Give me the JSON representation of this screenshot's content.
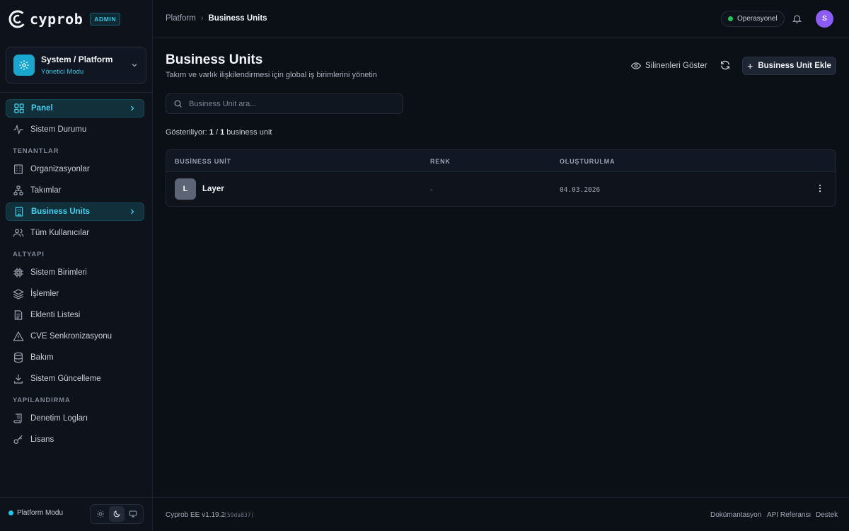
{
  "brand": {
    "name": "cyprob",
    "badge": "ADMIN"
  },
  "workspace": {
    "title": "System / Platform",
    "subtitle": "Yönetici Modu"
  },
  "nav": {
    "items_top": [
      {
        "label": "Panel",
        "icon": "dashboard-icon",
        "active": true
      },
      {
        "label": "Sistem Durumu",
        "icon": "activity-icon"
      }
    ],
    "sections": [
      {
        "label": "TENANTLAR",
        "items": [
          {
            "label": "Organizasyonlar",
            "icon": "building-icon"
          },
          {
            "label": "Takımlar",
            "icon": "network-icon"
          },
          {
            "label": "Business Units",
            "icon": "office-icon",
            "active": true
          },
          {
            "label": "Tüm Kullanıcılar",
            "icon": "users-icon"
          }
        ]
      },
      {
        "label": "ALTYAPI",
        "items": [
          {
            "label": "Sistem Birimleri",
            "icon": "cpu-icon"
          },
          {
            "label": "İşlemler",
            "icon": "layers-icon"
          },
          {
            "label": "Eklenti Listesi",
            "icon": "list-icon"
          },
          {
            "label": "CVE Senkronizasyonu",
            "icon": "warning-icon"
          },
          {
            "label": "Bakım",
            "icon": "database-icon"
          },
          {
            "label": "Sistem Güncelleme",
            "icon": "download-icon"
          }
        ]
      },
      {
        "label": "YAPILANDIRMA",
        "items": [
          {
            "label": "Denetim Logları",
            "icon": "scroll-icon"
          },
          {
            "label": "Lisans",
            "icon": "key-icon"
          }
        ]
      }
    ]
  },
  "sidebar_footer": {
    "mode_label": "Platform Modu",
    "theme": "dark"
  },
  "topbar": {
    "breadcrumb": [
      "Platform",
      "Business Units"
    ],
    "status": "Operasyonel",
    "avatar_initial": "S"
  },
  "page": {
    "title": "Business Units",
    "subtitle": "Takım ve varlık ilişkilendirmesi için global iş birimlerini yönetin",
    "show_deleted_label": "Silinenleri Göster",
    "add_label": "Business Unit Ekle",
    "search_placeholder": "Business Unit ara...",
    "count": {
      "prefix": "Gösteriliyor:",
      "shown": "1",
      "sep": "/",
      "total": "1",
      "suffix": "business unit"
    }
  },
  "table": {
    "headers": [
      "BUSİNESS UNİT",
      "RENK",
      "OLUŞTURULMA"
    ],
    "rows": [
      {
        "initial": "L",
        "name": "Layer",
        "color": "-",
        "created": "04.03.2026"
      }
    ]
  },
  "footer": {
    "version": "Cyprob EE v1.19.2",
    "hash": "(59da837)",
    "links": [
      "Dokümantasyon",
      "API Referansı",
      "Destek"
    ]
  },
  "colors": {
    "accent": "#3fd0ee",
    "status_ok": "#22c55e",
    "avatar": "#8b5cf6"
  }
}
